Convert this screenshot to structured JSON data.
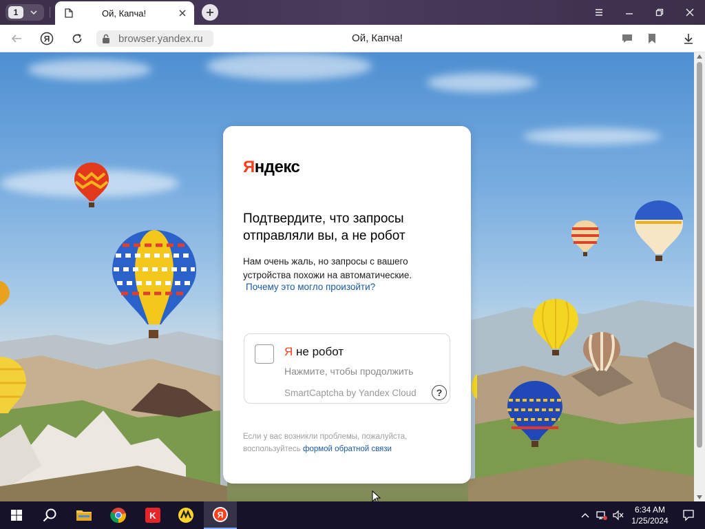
{
  "browser": {
    "tab_count": "1",
    "active_tab_title": "Ой, Капча!",
    "url": "browser.yandex.ru",
    "page_title": "Ой, Капча!"
  },
  "captcha_page": {
    "logo_first": "Я",
    "logo_rest": "ндекс",
    "heading": "Подтвердите, что запросы отправляли вы, а не робот",
    "description": "Нам очень жаль, но запросы с вашего устройства похожи на автоматические.",
    "why_link": "Почему это могло произойти?",
    "checkbox_ya": "Я",
    "checkbox_label": " не робот",
    "hint": "Нажмите, чтобы продолжить",
    "brand": "SmartCaptcha by Yandex Cloud",
    "help_icon_text": "?",
    "footer_text": "Если у вас возникли проблемы, пожалуйста, воспользуйтесь ",
    "footer_link": "формой обратной связи"
  },
  "taskbar": {
    "time": "6:34 AM",
    "date": "1/25/2024",
    "items": [
      "start",
      "search",
      "file-explorer",
      "chrome",
      "kaspersky",
      "yandex-market",
      "yandex-browser"
    ]
  },
  "colors": {
    "yandex_red": "#fc3f1d",
    "link_blue": "#1a5aa8",
    "titlebar": "#3c2f4a",
    "taskbar": "#15122a"
  }
}
